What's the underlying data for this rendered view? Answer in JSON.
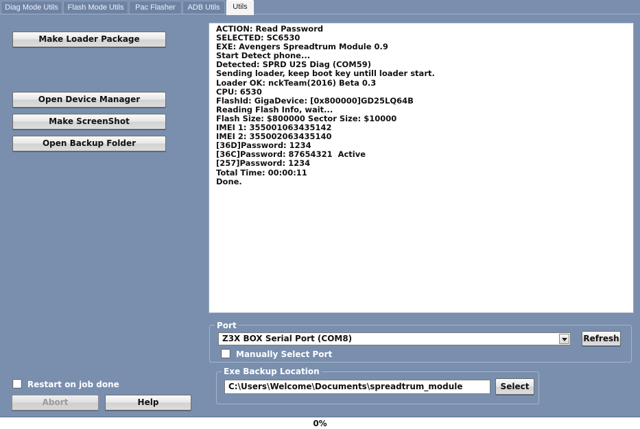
{
  "tabs": [
    {
      "label": "Diag Mode Utils",
      "active": false
    },
    {
      "label": "Flash Mode Utils",
      "active": false
    },
    {
      "label": "Pac Flasher",
      "active": false
    },
    {
      "label": "ADB Utils",
      "active": false
    },
    {
      "label": "Utils",
      "active": true
    }
  ],
  "left_panel": {
    "make_loader_label": "Make Loader Package",
    "open_device_manager_label": "Open Device Manager",
    "make_screenshot_label": "Make ScreenShot",
    "open_backup_folder_label": "Open Backup Folder",
    "restart_on_job_done_label": "Restart on job done",
    "restart_on_job_done_checked": false,
    "abort_label": "Abort",
    "help_label": "Help"
  },
  "log": {
    "lines": [
      "ACTION: Read Password",
      "SELECTED: SC6530",
      "EXE: Avengers Spreadtrum Module 0.9",
      "Start Detect phone...",
      "Detected: SPRD U2S Diag (COM59)",
      "Sending loader, keep boot key untill loader start.",
      "Loader OK: nckTeam(2016) Beta 0.3",
      "CPU: 6530",
      "FlashId: GigaDevice: [0x800000]GD25LQ64B",
      "Reading Flash Info, wait...",
      "Flash Size: $800000 Sector Size: $10000",
      "IMEI 1: 355001063435142",
      "IMEI 2: 355002063435140",
      "[36D]Password: 1234",
      "[36C]Password: 87654321  Active",
      "[257]Password: 1234",
      "Total Time: 00:00:11",
      "Done."
    ]
  },
  "port": {
    "group_title": "Port",
    "selected_port": "Z3X BOX Serial Port (COM8)",
    "refresh_label": "Refresh",
    "manually_select_label": "Manually Select Port",
    "manually_select_checked": false
  },
  "backup": {
    "group_title": "Exe Backup Location",
    "path": "C:\\Users\\Welcome\\Documents\\spreadtrum_module",
    "select_label": "Select"
  },
  "progress": {
    "text": "0%",
    "value": 0
  }
}
